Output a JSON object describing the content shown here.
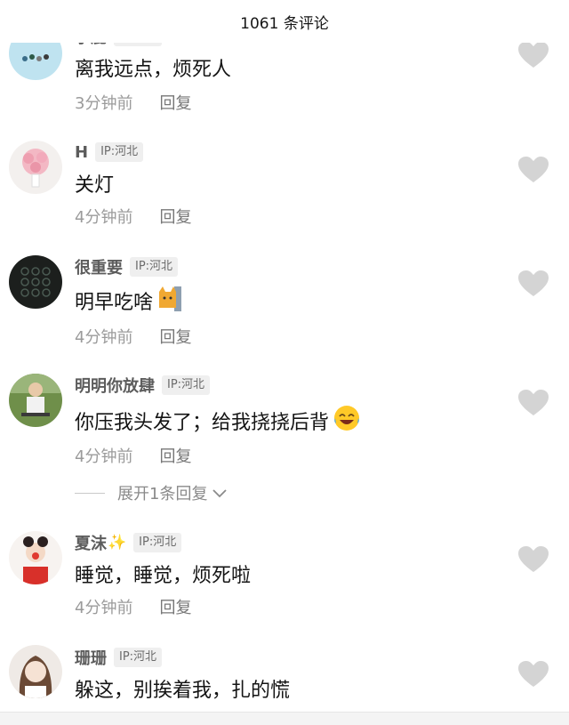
{
  "header": {
    "title": "1061 条评论"
  },
  "icons": {
    "like": "heart-icon",
    "expand": "chevron-down-icon"
  },
  "comments": [
    {
      "name": "小鹿",
      "ip": "IP:河南",
      "text": "离我远点，烦死人",
      "time": "3分钟前",
      "reply": "回复"
    },
    {
      "name": "H",
      "ip": "IP:河北",
      "text": "关灯",
      "time": "4分钟前",
      "reply": "回复"
    },
    {
      "name": "很重要",
      "ip": "IP:河北",
      "text": "明早吃啥",
      "time": "4分钟前",
      "reply": "回复"
    },
    {
      "name": "明明你放肆",
      "ip": "IP:河北",
      "text": "你压我头发了；给我挠挠后背",
      "time": "4分钟前",
      "reply": "回复"
    },
    {
      "name": "夏沫",
      "ip": "IP:河北",
      "text": "睡觉，睡觉，烦死啦",
      "time": "4分钟前",
      "reply": "回复"
    },
    {
      "name": "珊珊",
      "ip": "IP:河北",
      "text": "躲这，别挨着我，扎的慌"
    }
  ],
  "expand_replies": {
    "label": "展开1条回复"
  },
  "colors": {
    "heart": "#d4d4d4",
    "ip_bg": "#efefef",
    "meta": "#9b9b9b",
    "username": "#5c5c5c"
  }
}
